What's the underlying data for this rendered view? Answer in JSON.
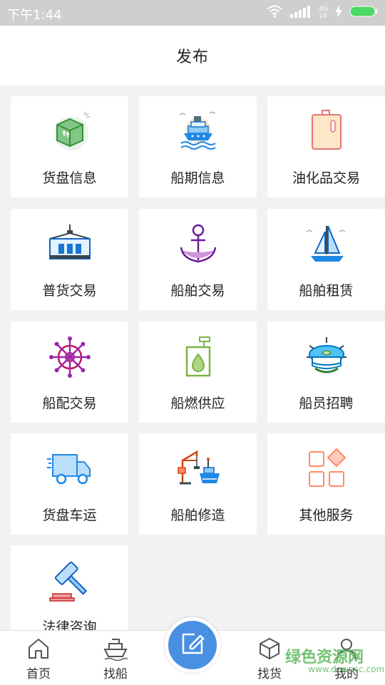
{
  "status_bar": {
    "time": "下午1:44",
    "network": "4G",
    "network_sub": "1X"
  },
  "header": {
    "title": "发布"
  },
  "tiles": [
    {
      "label": "货盘信息",
      "icon": "cargo-box-icon"
    },
    {
      "label": "船期信息",
      "icon": "ship-schedule-icon"
    },
    {
      "label": "油化品交易",
      "icon": "oil-tank-icon"
    },
    {
      "label": "普货交易",
      "icon": "container-icon"
    },
    {
      "label": "船舶交易",
      "icon": "anchor-icon"
    },
    {
      "label": "船舶租赁",
      "icon": "sailboat-icon"
    },
    {
      "label": "船配交易",
      "icon": "ship-wheel-icon"
    },
    {
      "label": "船燃供应",
      "icon": "fuel-can-icon"
    },
    {
      "label": "船员招聘",
      "icon": "captain-hat-icon"
    },
    {
      "label": "货盘车运",
      "icon": "truck-icon"
    },
    {
      "label": "船舶修造",
      "icon": "shipyard-crane-icon"
    },
    {
      "label": "其他服务",
      "icon": "grid-apps-icon"
    },
    {
      "label": "法律咨询",
      "icon": "gavel-icon"
    }
  ],
  "tabbar": {
    "items": [
      {
        "label": "首页",
        "icon": "home-icon"
      },
      {
        "label": "找船",
        "icon": "ship-icon"
      },
      {
        "label": "找货",
        "icon": "box-icon"
      },
      {
        "label": "我的",
        "icon": "user-icon"
      }
    ],
    "publish_icon": "edit-icon"
  },
  "watermark": {
    "text": "绿色资源网",
    "url": "www.downcc.com"
  },
  "colors": {
    "accent": "#4a90e2",
    "statusbar": "#cfcfcf",
    "background": "#f2f2f2"
  }
}
